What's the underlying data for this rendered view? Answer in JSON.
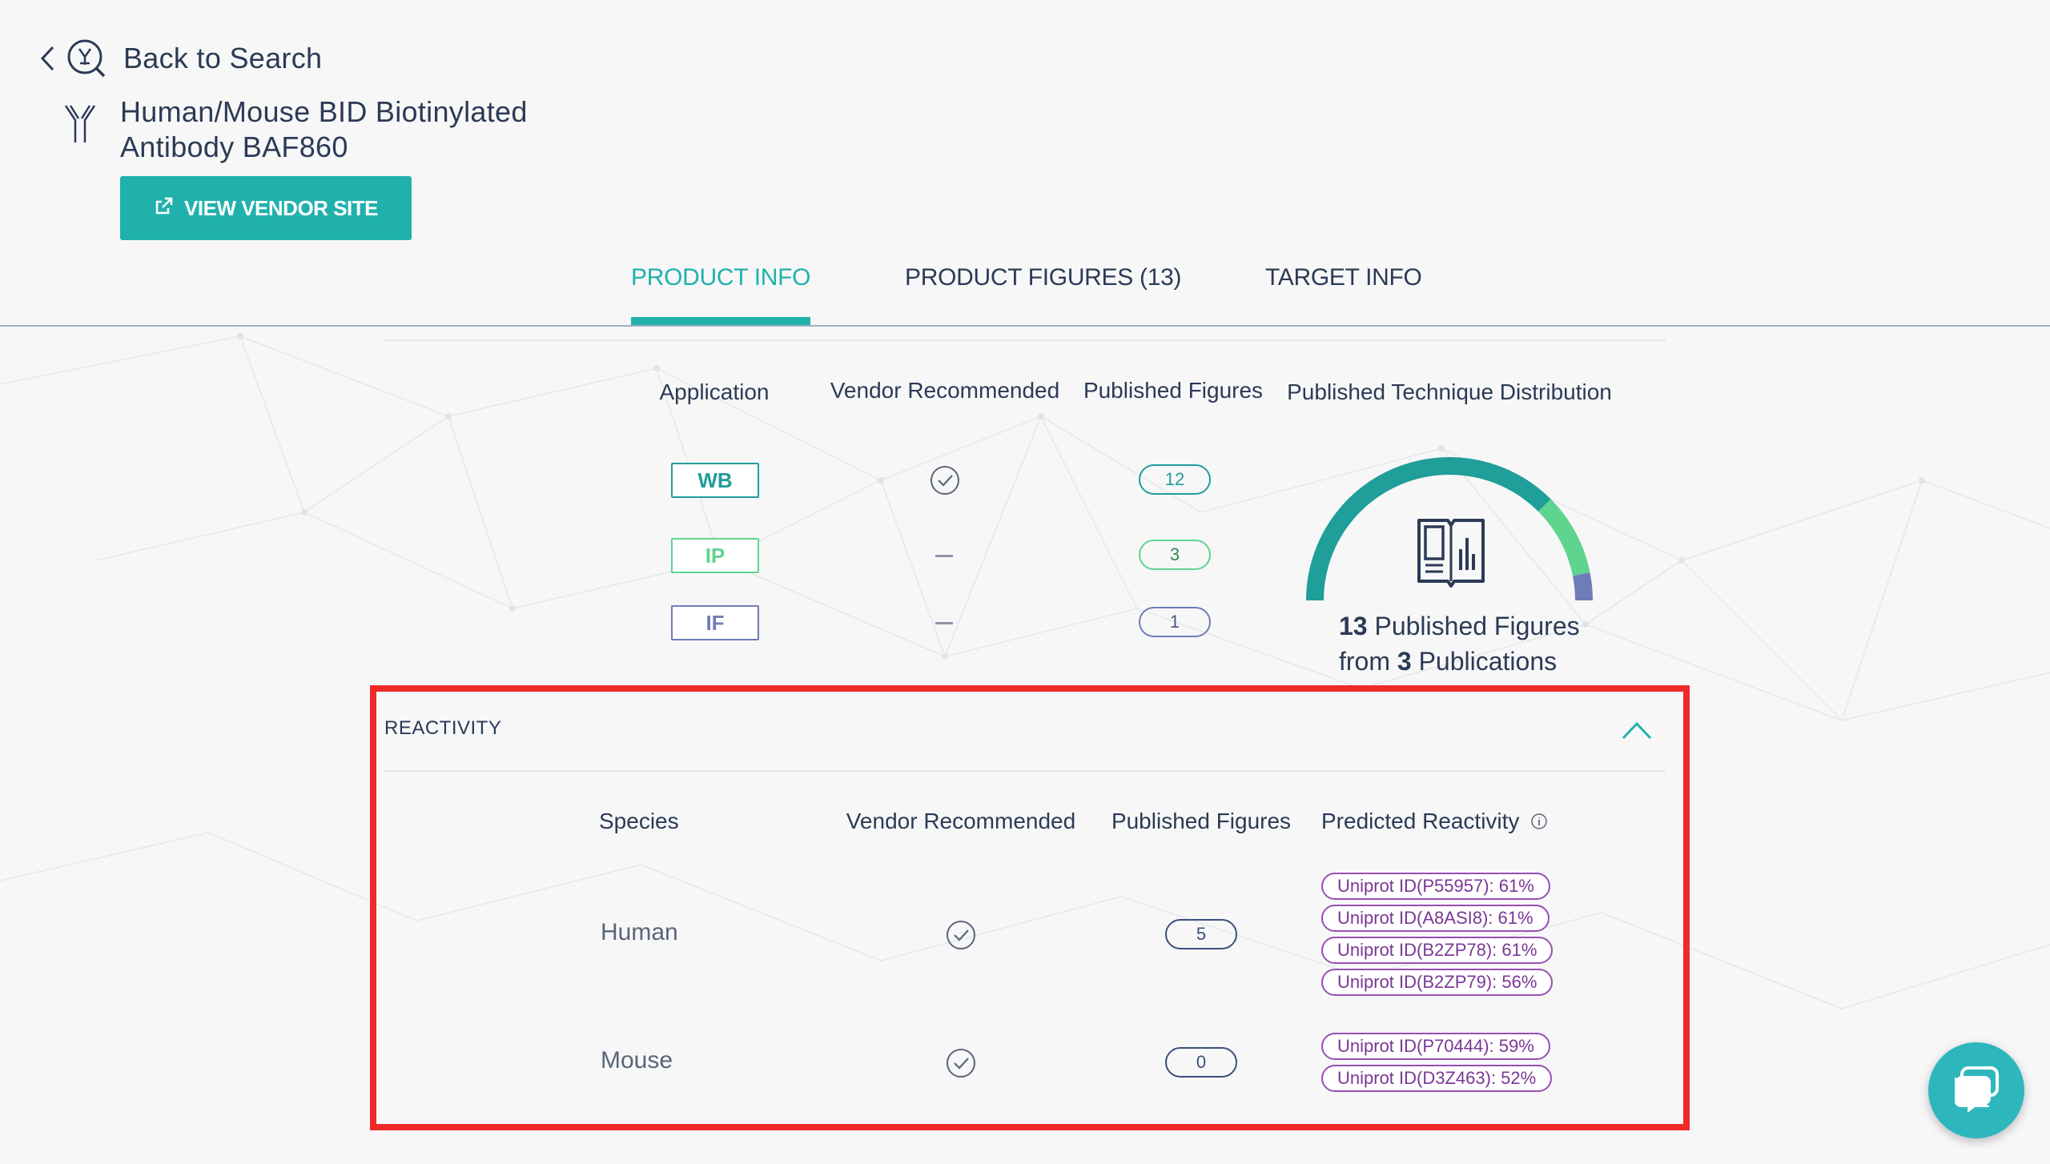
{
  "header": {
    "back_label": "Back to Search",
    "product_title_line1": "Human/Mouse BID Biotinylated",
    "product_title_line2": "Antibody BAF860",
    "vendor_button_label": "VIEW VENDOR SITE"
  },
  "tabs": [
    {
      "label": "PRODUCT INFO",
      "active": true
    },
    {
      "label": "PRODUCT FIGURES (13)",
      "active": false
    },
    {
      "label": "TARGET INFO",
      "active": false
    }
  ],
  "applications": {
    "headers": {
      "application": "Application",
      "vendor_recommended": "Vendor Recommended",
      "published_figures": "Published Figures",
      "distribution": "Published Technique Distribution"
    },
    "rows": [
      {
        "app": "WB",
        "vendor_recommended": true,
        "figures": "12",
        "color": "#1f9e9a"
      },
      {
        "app": "IP",
        "vendor_recommended": false,
        "figures": "3",
        "color": "#5fd48f"
      },
      {
        "app": "IF",
        "vendor_recommended": false,
        "figures": "1",
        "color": "#6f7cb8"
      }
    ],
    "summary": {
      "figures_count": "13",
      "figures_label": "Published Figures",
      "from_label": "from",
      "publications_count": "3",
      "publications_label": "Publications"
    }
  },
  "reactivity": {
    "title": "REACTIVITY",
    "headers": {
      "species": "Species",
      "vendor_recommended": "Vendor Recommended",
      "published_figures": "Published Figures",
      "predicted_reactivity": "Predicted Reactivity"
    },
    "rows": [
      {
        "species": "Human",
        "vendor_recommended": true,
        "figures": "5",
        "uniprot": [
          "Uniprot ID(P55957): 61%",
          "Uniprot ID(A8ASI8): 61%",
          "Uniprot ID(B2ZP78): 61%",
          "Uniprot ID(B2ZP79): 56%"
        ]
      },
      {
        "species": "Mouse",
        "vendor_recommended": true,
        "figures": "0",
        "uniprot": [
          "Uniprot ID(P70444): 59%",
          "Uniprot ID(D3Z463): 52%"
        ]
      }
    ]
  },
  "colors": {
    "accent": "#21b1ad",
    "text": "#2b3a55",
    "highlight_box": "#f02929",
    "uniprot_purple": "#9a4db3",
    "figure_pill_blue": "#3b4f7a"
  }
}
